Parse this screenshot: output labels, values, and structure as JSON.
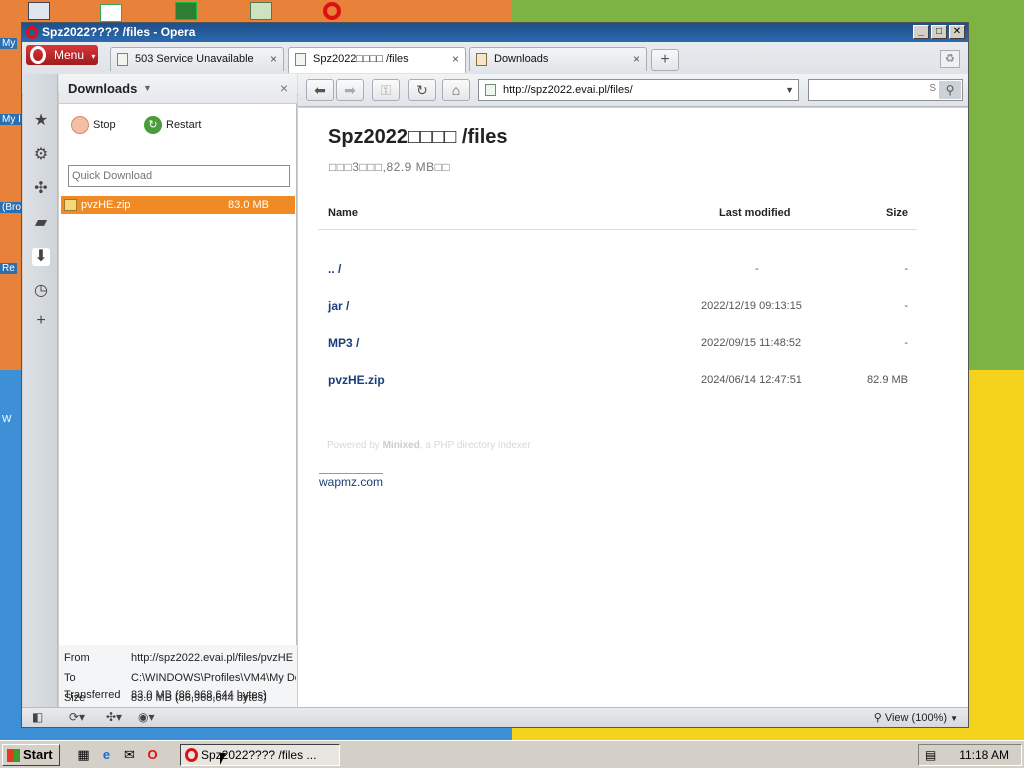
{
  "desktop": {
    "labels": [
      "My",
      "My I",
      "(Bro",
      "Re",
      "W"
    ]
  },
  "window": {
    "title": "Spz2022???? /files - Opera"
  },
  "menu": {
    "label": "Menu"
  },
  "tabs": [
    {
      "label": "503 Service Unavailable",
      "active": false
    },
    {
      "label": "Spz2022□□□□ /files",
      "active": true
    },
    {
      "label": "Downloads",
      "active": false
    }
  ],
  "downloads_panel": {
    "title": "Downloads",
    "stop_label": "Stop",
    "restart_label": "Restart",
    "quick_download_placeholder": "Quick Download",
    "items": [
      {
        "name": "pvzHE.zip",
        "size": "83.0 MB"
      }
    ],
    "details": {
      "from_key": "From",
      "from_val": "http://spz2022.evai.pl/files/pvzHE",
      "to_key": "To",
      "to_val": "C:\\WINDOWS\\Profiles\\VM4\\My Do",
      "size_key": "Size",
      "size_val": "83.0 MB (86,968,644 bytes)",
      "transferred_key": "Transferred",
      "transferred_val": "83.0 MB (86,968,644 bytes)"
    }
  },
  "address_bar": {
    "url": "http://spz2022.evai.pl/files/",
    "search_value": "S"
  },
  "page": {
    "title": "Spz2022□□□□ /files",
    "subtitle": "□□□3□□□,82.9 MB□□",
    "headers": {
      "name": "Name",
      "modified": "Last modified",
      "size": "Size"
    },
    "rows": [
      {
        "name": ".. /",
        "modified": "-",
        "size": "-"
      },
      {
        "name": "jar /",
        "modified": "2022/12/19 09:13:15",
        "size": "-"
      },
      {
        "name": "MP3 /",
        "modified": "2022/09/15 11:48:52",
        "size": "-"
      },
      {
        "name": "pvzHE.zip",
        "modified": "2024/06/14 12:47:51",
        "size": "82.9 MB"
      }
    ],
    "powered_prefix": "Powered by",
    "powered_brand": "Minixed",
    "powered_suffix": ", a PHP directory indexer",
    "footer_link": "wapmz.com"
  },
  "statusbar": {
    "view_label": "View (100%)"
  },
  "taskbar": {
    "start_label": "Start",
    "task_label": "Spz2022???? /files ...",
    "clock": "11:18 AM"
  }
}
